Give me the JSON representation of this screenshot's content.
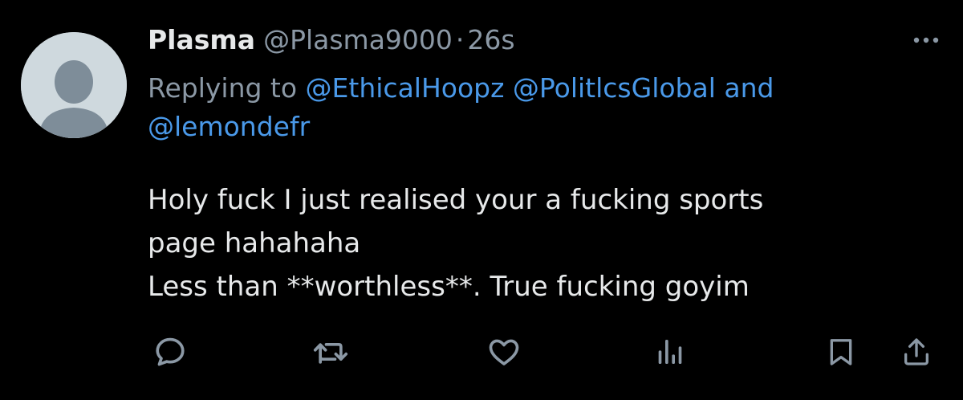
{
  "tweet": {
    "display_name": "Plasma",
    "handle": "@Plasma9000",
    "separator": "·",
    "time": "26s",
    "replying_prefix": "Replying to ",
    "mentions": [
      "@EthicalHoopz",
      "@PolitlcsGlobal",
      "@lemondefr"
    ],
    "mention_joiner": "and",
    "body_lines": [
      "Holy fuck I just realised your a fucking sports",
      "page hahahaha",
      "Less than **worthless**. True fucking goyim"
    ]
  },
  "actions": {
    "icons": [
      "reply-icon",
      "retweet-icon",
      "like-icon",
      "views-icon",
      "bookmark-icon",
      "share-icon"
    ]
  },
  "colors": {
    "background": "#000000",
    "primary_text": "#e7e9ea",
    "secondary_text": "#8b98a5",
    "link": "#4a99e9",
    "icon": "#8b98a5",
    "avatar_bg": "#cfd9de",
    "avatar_figure": "#7e8d99"
  }
}
